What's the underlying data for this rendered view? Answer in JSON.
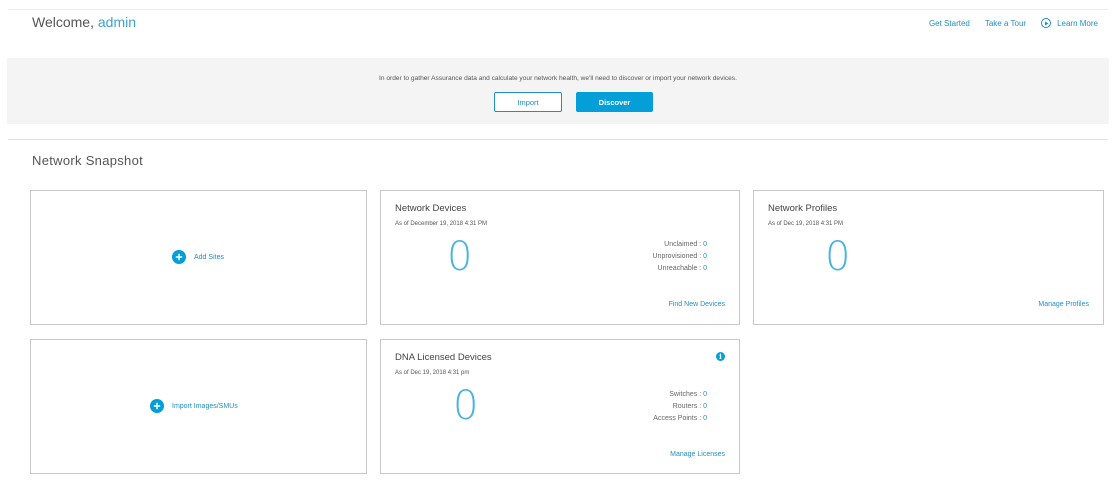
{
  "header": {
    "welcome_prefix": "Welcome,",
    "username": "admin",
    "links": {
      "get_started": "Get Started",
      "take_tour": "Take a Tour",
      "learn_more": "Learn More"
    }
  },
  "banner": {
    "message": "In order to gather Assurance data and calculate your network health, we'll need to discover or import your network devices.",
    "import_label": "Import",
    "discover_label": "Discover"
  },
  "snapshot": {
    "title": "Network Snapshot",
    "add_sites": "Add Sites",
    "import_images": "Import Images/SMUs",
    "network_devices": {
      "title": "Network Devices",
      "as_of": "As of December 19, 2018 4:31 PM",
      "count": "0",
      "unclaimed_label": "Unclaimed :",
      "unclaimed": "0",
      "unprovisioned_label": "Unprovisioned :",
      "unprovisioned": "0",
      "unreachable_label": "Unreachable :",
      "unreachable": "0",
      "link": "Find New Devices"
    },
    "network_profiles": {
      "title": "Network Profiles",
      "as_of": "As of Dec 19, 2018 4:31 PM",
      "count": "0",
      "link": "Manage Profiles"
    },
    "dna_licensed": {
      "title": "DNA Licensed Devices",
      "as_of": "As of Dec 19, 2018 4:31 pm",
      "count": "0",
      "switches_label": "Switches :",
      "switches": "0",
      "routers_label": "Routers :",
      "routers": "0",
      "access_points_label": "Access Points :",
      "access_points": "0",
      "link": "Manage Licenses"
    }
  },
  "colors": {
    "accent": "#049fd9",
    "link": "#1f8fc6",
    "big_number": "#49b3e0"
  }
}
